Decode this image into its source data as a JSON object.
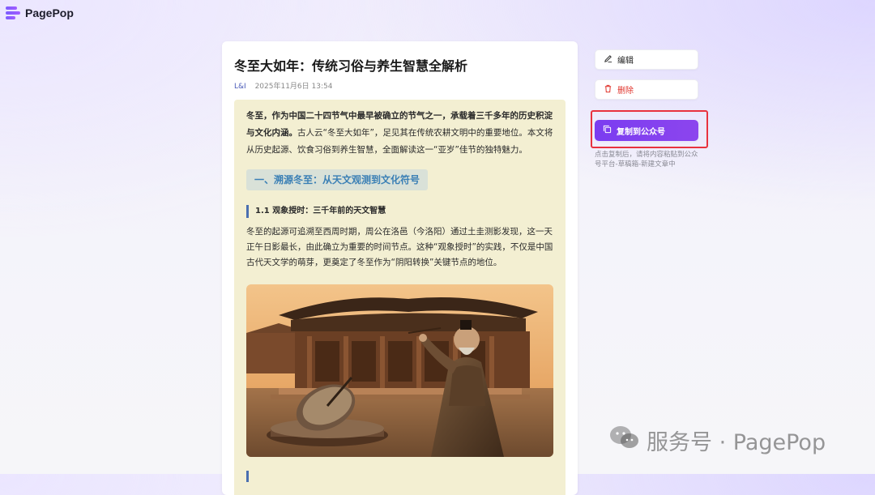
{
  "app": {
    "name": "PagePop"
  },
  "article": {
    "title": "冬至大如年：传统习俗与养生智慧全解析",
    "author": "L&I",
    "date": "2025年11月6日 13:54",
    "intro_bold": "冬至，作为中国二十四节气中最早被确立的节气之一，承载着三千多年的历史积淀与文化内涵。",
    "intro_rest": "古人云“冬至大如年”，足见其在传统农耕文明中的重要地位。本文将从历史起源、饮食习俗到养生智慧，全面解读这一“亚岁”佳节的独特魅力。",
    "section_title": "一、溯源冬至：从天文观测到文化符号",
    "subsection_title": "1.1 观象授时：三千年前的天文智慧",
    "paragraph": "冬至的起源可追溯至西周时期，周公在洛邑（今洛阳）通过土圭测影发现，这一天正午日影最长，由此确立为重要的时间节点。这种“观象授时”的实践，不仅是中国古代天文学的萌芽，更奠定了冬至作为“阴阳转换”关键节点的地位。"
  },
  "actions": {
    "edit_label": "编辑",
    "delete_label": "删除",
    "copy_label": "复制到公众号",
    "copy_hint": "点击复制后，请将内容粘贴到公众号平台-草稿箱-新建文章中"
  },
  "watermark": {
    "text": "服务号 · PagePop"
  },
  "colors": {
    "accent": "#7b3df0",
    "danger": "#e0342c",
    "content_bg": "#f3efd2",
    "highlight_border": "#e8323e"
  }
}
